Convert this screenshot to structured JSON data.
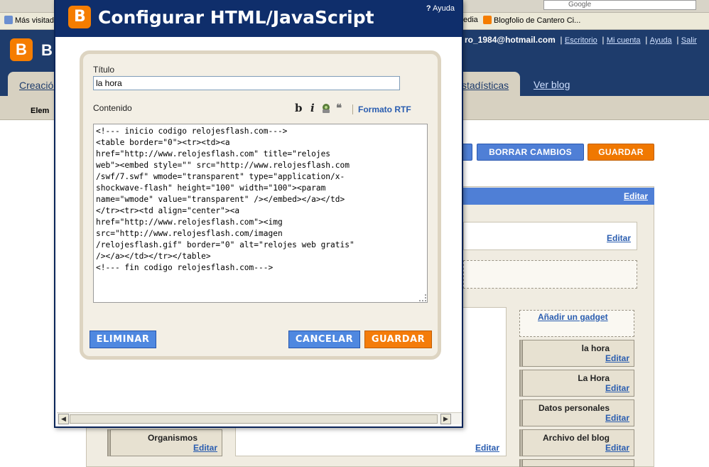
{
  "background": {
    "bookmarks": {
      "item1": "Más visitados",
      "item2": "edia",
      "item3": "Blogfolio de Cantero Ci..."
    },
    "search_placeholder": "Google",
    "logo_letter": "B",
    "user": {
      "email": "ro_1984@hotmail.com",
      "links": [
        "Escritorio",
        "Mi cuenta",
        "Ayuda",
        "Salir"
      ]
    },
    "tabs": {
      "first": "Creación",
      "stats": "stadísticas",
      "view_blog": "Ver blog"
    },
    "subbar_label": "Elem",
    "buttons": {
      "discard": "BORRAR CAMBIOS",
      "save": "GUARDAR"
    },
    "edit_label": "Editar",
    "add_gadget": "Añadir un gadget",
    "gadgets": [
      "la hora",
      "La Hora",
      "Datos personales",
      "Archivo del blog"
    ],
    "left_gadget": "Organismos"
  },
  "dialog": {
    "title": "Configurar HTML/JavaScript",
    "help": "Ayuda",
    "title_label": "Título",
    "title_value": "la hora",
    "content_label": "Contenido",
    "toolbar": {
      "bold": "b",
      "italic": "i",
      "quote": "❝",
      "rtf": "Formato RTF"
    },
    "content_value": "<!--- inicio codigo relojesflash.com--->\n<table border=\"0\"><tr><td><a\nhref=\"http://www.relojesflash.com\" title=\"relojes\nweb\"><embed style=\"\" src=\"http://www.relojesflash.com\n/swf/7.swf\" wmode=\"transparent\" type=\"application/x-\nshockwave-flash\" height=\"100\" width=\"100\"><param\nname=\"wmode\" value=\"transparent\" /></embed></a></td>\n</tr><tr><td align=\"center\"><a\nhref=\"http://www.relojesflash.com\"><img\nsrc=\"http://www.relojesflash.com/imagen\n/relojesflash.gif\" border=\"0\" alt=\"relojes web gratis\"\n/></a></td></tr></table>\n<!--- fin codigo relojesflash.com--->",
    "buttons": {
      "delete": "ELIMINAR",
      "cancel": "CANCELAR",
      "save": "GUARDAR"
    }
  },
  "colors": {
    "header_blue": "#0f2e6b",
    "accent_orange": "#f47c0a",
    "button_blue": "#4f88e0",
    "panel_beige": "#f3efe5"
  }
}
